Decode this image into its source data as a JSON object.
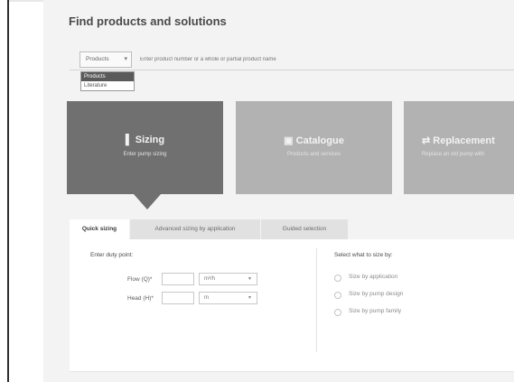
{
  "page": {
    "title": "Find products and solutions"
  },
  "search": {
    "select_value": "Products",
    "placeholder": "Enter product number or a whole or partial product name",
    "dropdown_options": [
      "Products",
      "Literature"
    ]
  },
  "tiles": [
    {
      "title": "Sizing",
      "subtitle": "Enter pump sizing",
      "icon": "sizing-icon"
    },
    {
      "title": "Catalogue",
      "subtitle": "Products and services",
      "icon": "catalogue-icon"
    },
    {
      "title": "Replacement",
      "subtitle": "Replace an old pump with",
      "icon": "replace-icon"
    }
  ],
  "tabs": [
    {
      "label": "Quick sizing",
      "active": true
    },
    {
      "label": "Advanced sizing by application",
      "active": false
    },
    {
      "label": "Guided selection",
      "active": false
    }
  ],
  "duty_point": {
    "heading": "Enter duty point:",
    "flow_label": "Flow (Q)*",
    "flow_unit": "m³/h",
    "head_label": "Head (H)*",
    "head_unit": "m"
  },
  "size_by": {
    "heading": "Select what to size by:",
    "options": [
      "Size by application",
      "Size by pump design",
      "Size by pump family"
    ]
  },
  "colors": {
    "active_tile": "#707070",
    "inactive_tile": "#b2b2b2",
    "panel_bg": "#f3f3f3"
  }
}
